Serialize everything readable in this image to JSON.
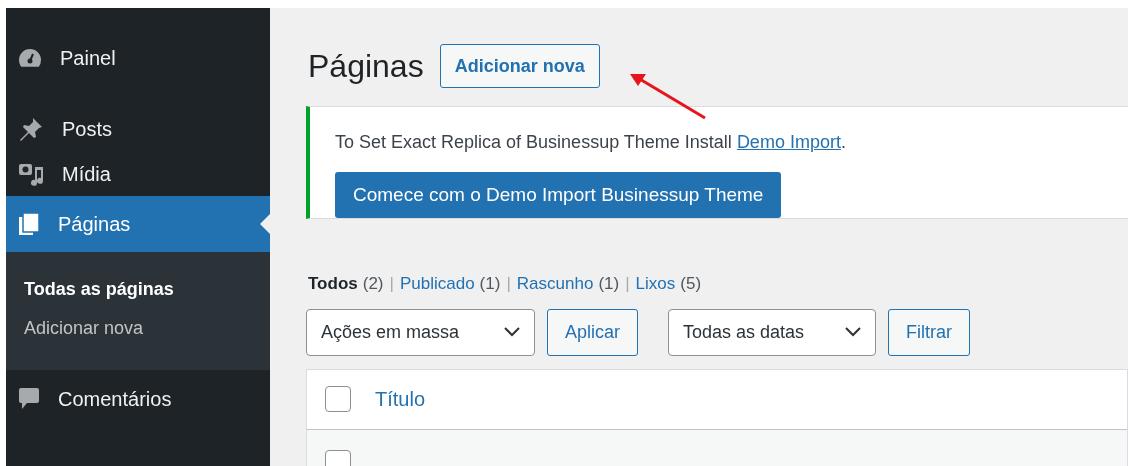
{
  "sidebar": {
    "items": [
      {
        "label": "Painel",
        "kind": "dashboard",
        "selected": false
      },
      {
        "label": "Posts",
        "kind": "posts",
        "selected": false
      },
      {
        "label": "Mídia",
        "kind": "media",
        "selected": false
      },
      {
        "label": "Páginas",
        "kind": "pages",
        "selected": true,
        "children": [
          {
            "label": "Todas as páginas",
            "selected": true
          },
          {
            "label": "Adicionar nova",
            "selected": false
          }
        ]
      },
      {
        "label": "Comentários",
        "kind": "comments",
        "selected": false
      }
    ]
  },
  "page": {
    "title": "Páginas",
    "add_button": "Adicionar nova"
  },
  "notice": {
    "text": "To Set Exact Replica of Businessup Theme Install ",
    "link": "Demo Import",
    "after": ".",
    "button": "Comece com o Demo Import Businessup Theme"
  },
  "filters": [
    {
      "label": "Todos",
      "count": "(2)",
      "selected": true
    },
    {
      "separator": "|",
      "label": "Publicado",
      "count": "(1)",
      "selected": false
    },
    {
      "separator": "|",
      "label": "Rascunho",
      "count": "(1)",
      "selected": false
    },
    {
      "separator": "|",
      "label": "Lixos",
      "count": "(5)",
      "selected": false
    }
  ],
  "bulk_actions": {
    "value": "Ações em massa",
    "button": "Aplicar"
  },
  "date_filter": {
    "value": "Todas as datas",
    "button": "Filtrar"
  },
  "table": {
    "columns": [
      {
        "label": "Título",
        "checked": false
      }
    ],
    "rows": [
      {
        "checked": false
      }
    ]
  }
}
